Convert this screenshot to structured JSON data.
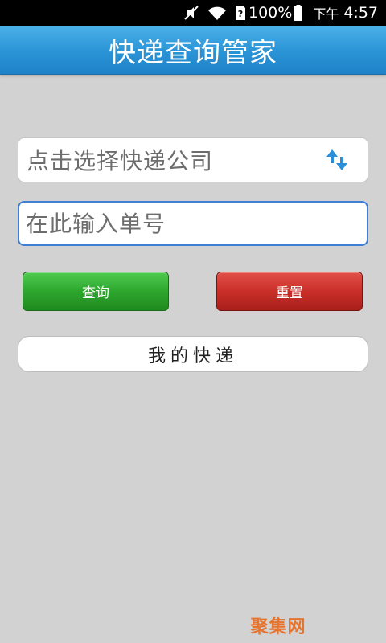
{
  "status_bar": {
    "battery": "100%",
    "period": "下午",
    "time": "4:57",
    "icons": [
      "mute-icon",
      "wifi-icon",
      "sim-card-icon",
      "battery-icon"
    ]
  },
  "header": {
    "title": "快递查询管家"
  },
  "form": {
    "company_placeholder": "点击选择快递公司",
    "tracking_placeholder": "在此输入单号",
    "tracking_value": ""
  },
  "actions": {
    "query_label": "查询",
    "reset_label": "重置",
    "my_parcels_label": "我的快递"
  },
  "watermark": {
    "text": "聚集网"
  },
  "colors": {
    "title_bar": "#2a93d6",
    "query_button": "#2ea62e",
    "reset_button": "#c92f28",
    "input_focus_border": "#3f7fd6",
    "background": "#d2d2d2"
  }
}
